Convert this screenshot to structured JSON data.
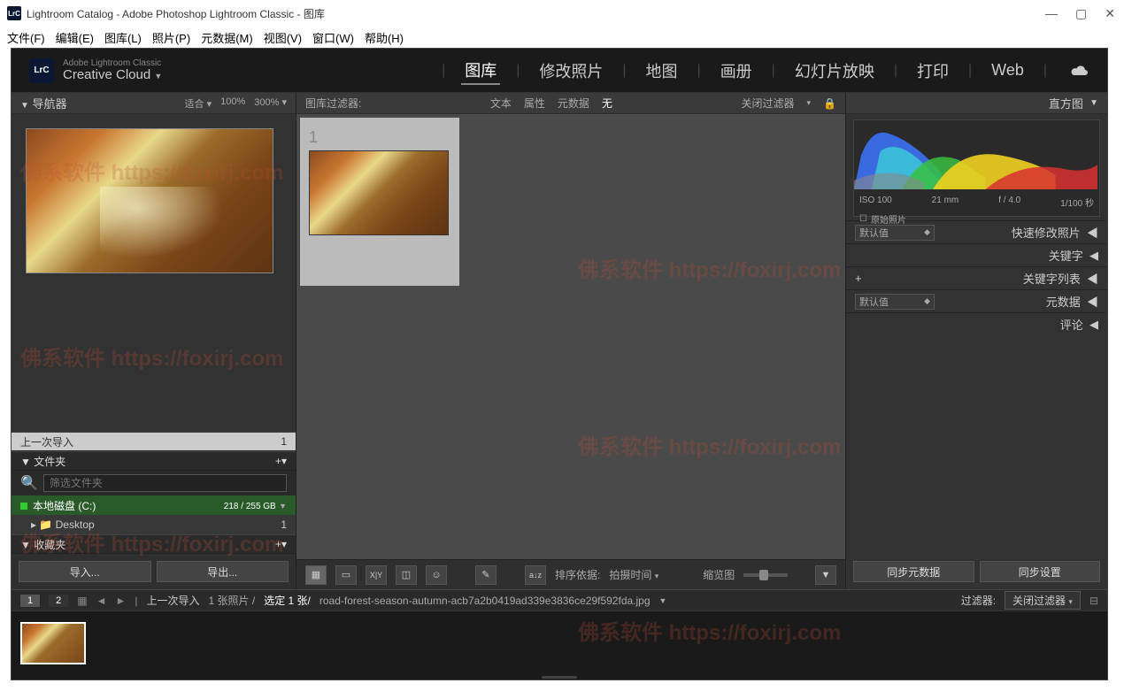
{
  "titlebar": {
    "app_icon": "LrC",
    "title": "Lightroom Catalog - Adobe Photoshop Lightroom Classic - 图库"
  },
  "menus": [
    "文件(F)",
    "编辑(E)",
    "图库(L)",
    "照片(P)",
    "元数据(M)",
    "视图(V)",
    "窗口(W)",
    "帮助(H)"
  ],
  "brand": {
    "icon": "LrC",
    "line1": "Adobe Lightroom Classic",
    "line2": "Creative Cloud"
  },
  "modules": [
    "图库",
    "修改照片",
    "地图",
    "画册",
    "幻灯片放映",
    "打印",
    "Web"
  ],
  "active_module": "图库",
  "navigator": {
    "title": "导航器",
    "zoom_levels": [
      "适合 ▾",
      "100%",
      "300% ▾"
    ]
  },
  "catalog": {
    "last_import": "上一次导入",
    "last_import_count": "1"
  },
  "folders": {
    "title": "文件夹",
    "search_placeholder": "筛选文件夹",
    "volume": "本地磁盘 (C:)",
    "volume_space": "218 / 255 GB",
    "folder1": "Desktop",
    "folder1_count": "1"
  },
  "collections": {
    "title": "收藏夹"
  },
  "left_buttons": {
    "import": "导入...",
    "export": "导出..."
  },
  "filter_bar": {
    "label": "图库过滤器:",
    "tabs": [
      "文本",
      "属性",
      "元数据",
      "无"
    ],
    "active": "无",
    "close": "关闭过滤器"
  },
  "grid": {
    "thumb_index": "1"
  },
  "toolbar": {
    "sort_label": "排序依据:",
    "sort_value": "拍摄时间",
    "thumb_label": "缩览图"
  },
  "histogram": {
    "title": "直方图",
    "iso": "ISO 100",
    "focal": "21 mm",
    "aperture": "f / 4.0",
    "shutter": "1/100 秒",
    "original": "原始照片"
  },
  "right_sections": {
    "quick": "快速修改照片",
    "quick_preset": "默认值",
    "keywords": "关键字",
    "keyword_list": "关键字列表",
    "metadata": "元数据",
    "metadata_preset": "默认值",
    "comments": "评论"
  },
  "right_buttons": {
    "sync_meta": "同步元数据",
    "sync_settings": "同步设置"
  },
  "statusbar": {
    "page1": "1",
    "page2": "2",
    "breadcrumb_source": "上一次导入",
    "count_text": "1 张照片 /",
    "selected_text": "选定 1 张/",
    "filename": "road-forest-season-autumn-acb7a2b0419ad339e3836ce29f592fda.jpg",
    "filter_label": "过滤器:",
    "filter_value": "关闭过滤器"
  },
  "watermarks": [
    "佛系软件 https://foxirj.com"
  ]
}
